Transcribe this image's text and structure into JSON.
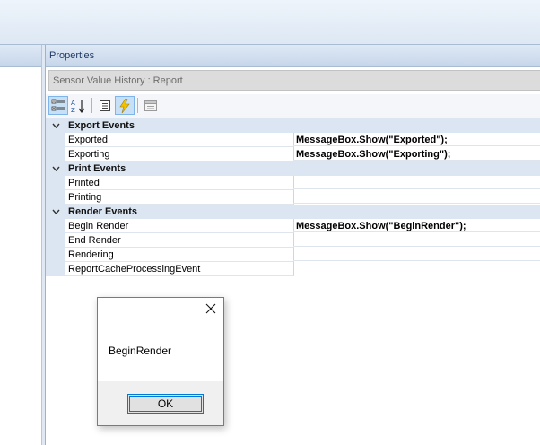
{
  "properties_panel": {
    "title": "Properties",
    "selected_object": "Sensor Value History : Report",
    "toolbar": [
      {
        "name": "categorized-icon",
        "active": true
      },
      {
        "name": "sort-alphabetical-icon",
        "active": false
      },
      {
        "name": "property-pages-icon",
        "active": false
      },
      {
        "name": "events-icon",
        "active": true
      },
      {
        "name": "object-properties-icon",
        "active": false
      }
    ],
    "categories": [
      {
        "label": "Export Events",
        "rows": [
          {
            "name": "Exported",
            "value": "MessageBox.Show(\"Exported\");"
          },
          {
            "name": "Exporting",
            "value": "MessageBox.Show(\"Exporting\");"
          }
        ]
      },
      {
        "label": "Print Events",
        "rows": [
          {
            "name": "Printed",
            "value": ""
          },
          {
            "name": "Printing",
            "value": ""
          }
        ]
      },
      {
        "label": "Render Events",
        "rows": [
          {
            "name": "Begin Render",
            "value": "MessageBox.Show(\"BeginRender\");"
          },
          {
            "name": "End Render",
            "value": ""
          },
          {
            "name": "Rendering",
            "value": ""
          },
          {
            "name": "ReportCacheProcessingEvent",
            "value": ""
          }
        ]
      }
    ]
  },
  "message_box": {
    "message": "BeginRender",
    "ok_label": "OK"
  },
  "colors": {
    "category_band": "#dce6f2",
    "title_text": "#1f3b66",
    "dialog_accent": "#0078d7"
  }
}
